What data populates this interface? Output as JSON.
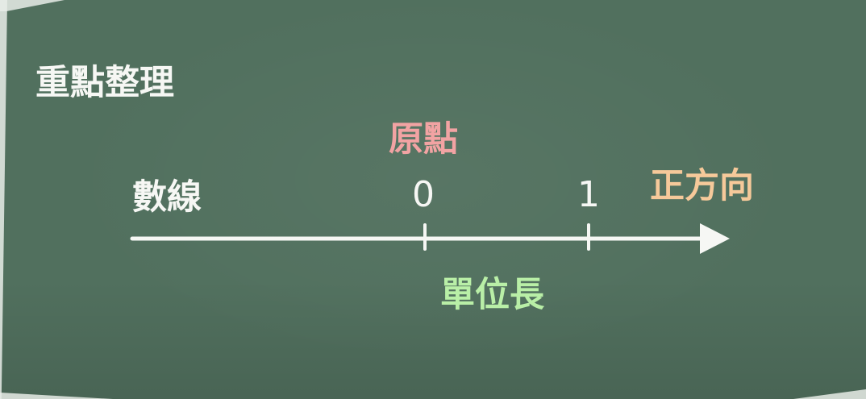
{
  "title": "重點整理",
  "number_line": {
    "label": "數線",
    "origin_label": "原點",
    "direction_label": "正方向",
    "unit_label": "單位長",
    "ticks": [
      {
        "value": 0,
        "label": "0"
      },
      {
        "value": 1,
        "label": "1"
      }
    ]
  },
  "colors": {
    "board": "#51705e",
    "chalk_white": "#f6f7f4",
    "origin": "#f2a3a3",
    "direction": "#f6c99a",
    "unit": "#b9efa7"
  }
}
